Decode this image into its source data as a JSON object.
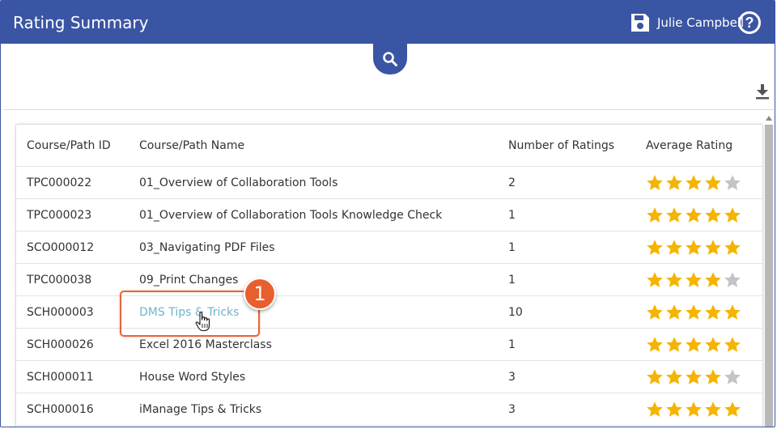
{
  "header": {
    "title": "Rating Summary",
    "user_name": "Julie Campbell",
    "help_glyph": "?",
    "save_icon": "floppy-disk-icon",
    "help_icon": "question-circle-icon"
  },
  "toolbar": {
    "search_icon": "magnifier-icon",
    "download_icon": "download-icon"
  },
  "table": {
    "columns": [
      "Course/Path ID",
      "Course/Path Name",
      "Number of Ratings",
      "Average Rating"
    ],
    "rows": [
      {
        "id": "TPC000022",
        "name": "01_Overview of Collaboration Tools",
        "count": "2",
        "rating": 4
      },
      {
        "id": "TPC000023",
        "name": "01_Overview of Collaboration Tools Knowledge Check",
        "count": "1",
        "rating": 5
      },
      {
        "id": "SCO000012",
        "name": "03_Navigating PDF Files",
        "count": "1",
        "rating": 5
      },
      {
        "id": "TPC000038",
        "name": "09_Print Changes",
        "count": "1",
        "rating": 4
      },
      {
        "id": "SCH000003",
        "name": "DMS Tips & Tricks",
        "count": "10",
        "rating": 5
      },
      {
        "id": "SCH000026",
        "name": "Excel 2016 Masterclass",
        "count": "1",
        "rating": 5
      },
      {
        "id": "SCH000011",
        "name": "House Word Styles",
        "count": "3",
        "rating": 4
      },
      {
        "id": "SCH000016",
        "name": "iManage Tips & Tricks",
        "count": "3",
        "rating": 5
      }
    ]
  },
  "callout": {
    "number": "1"
  },
  "colors": {
    "header_bg": "#3a55a3",
    "star_filled": "#f4b400",
    "star_empty": "#c4c4c4",
    "link": "#6fb3cf",
    "callout": "#e85f2e"
  }
}
